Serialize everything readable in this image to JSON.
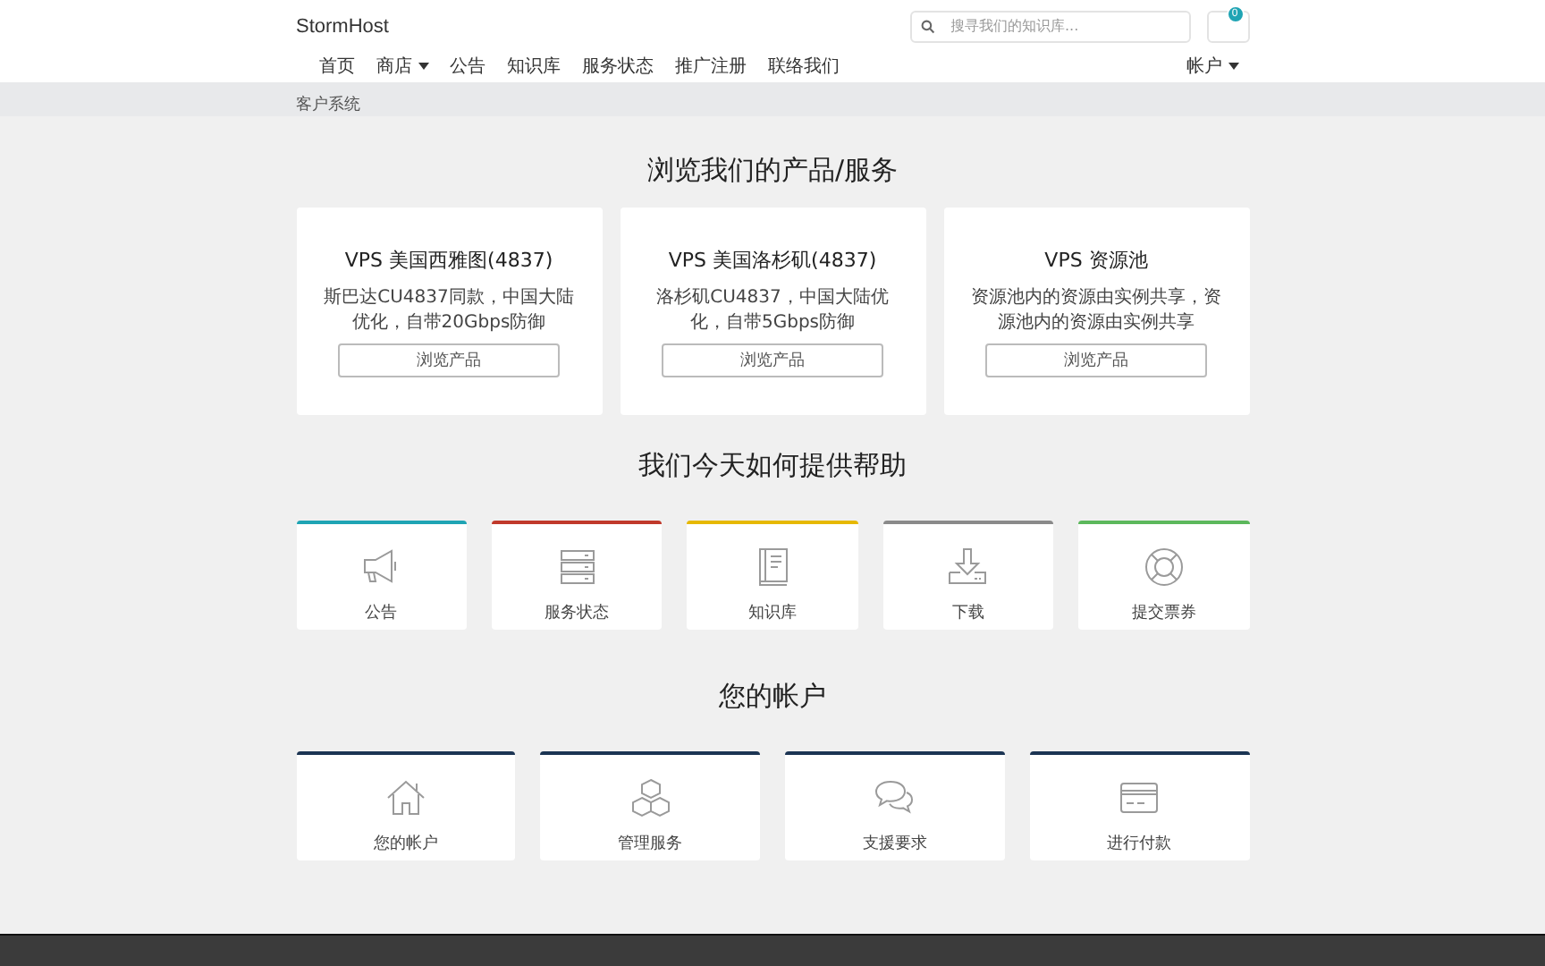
{
  "header": {
    "brand": "StormHost",
    "search": {
      "placeholder": "搜寻我们的知识库..."
    },
    "cart": {
      "count": "0"
    }
  },
  "nav": {
    "items": [
      {
        "label": "首页",
        "dropdown": false
      },
      {
        "label": "商店",
        "dropdown": true
      },
      {
        "label": "公告",
        "dropdown": false
      },
      {
        "label": "知识库",
        "dropdown": false
      },
      {
        "label": "服务状态",
        "dropdown": false
      },
      {
        "label": "推广注册",
        "dropdown": false
      },
      {
        "label": "联络我们",
        "dropdown": false
      }
    ],
    "account": {
      "label": "帐户",
      "dropdown": true
    }
  },
  "breadcrumb": "客户系统",
  "products": {
    "title": "浏览我们的产品/服务",
    "cards": [
      {
        "name": "VPS 美国西雅图(4837)",
        "description": "斯巴达CU4837同款，中国大陆优化，自带20Gbps防御",
        "button": "浏览产品"
      },
      {
        "name": "VPS 美国洛杉矶(4837)",
        "description": "洛杉矶CU4837，中国大陆优化，自带5Gbps防御",
        "button": "浏览产品"
      },
      {
        "name": "VPS 资源池",
        "description": "资源池内的资源由实例共享，资源池内的资源由实例共享",
        "button": "浏览产品"
      }
    ]
  },
  "help": {
    "title": "我们今天如何提供帮助",
    "tiles": [
      {
        "label": "公告",
        "color": "#1fa4b4"
      },
      {
        "label": "服务状态",
        "color": "#c0392b"
      },
      {
        "label": "知识库",
        "color": "#e6b800"
      },
      {
        "label": "下载",
        "color": "#8a8a8a"
      },
      {
        "label": "提交票券",
        "color": "#5cb85c"
      }
    ]
  },
  "account": {
    "title": "您的帐户",
    "tiles": [
      {
        "label": "您的帐户"
      },
      {
        "label": "管理服务"
      },
      {
        "label": "支援要求"
      },
      {
        "label": "进行付款"
      }
    ]
  }
}
